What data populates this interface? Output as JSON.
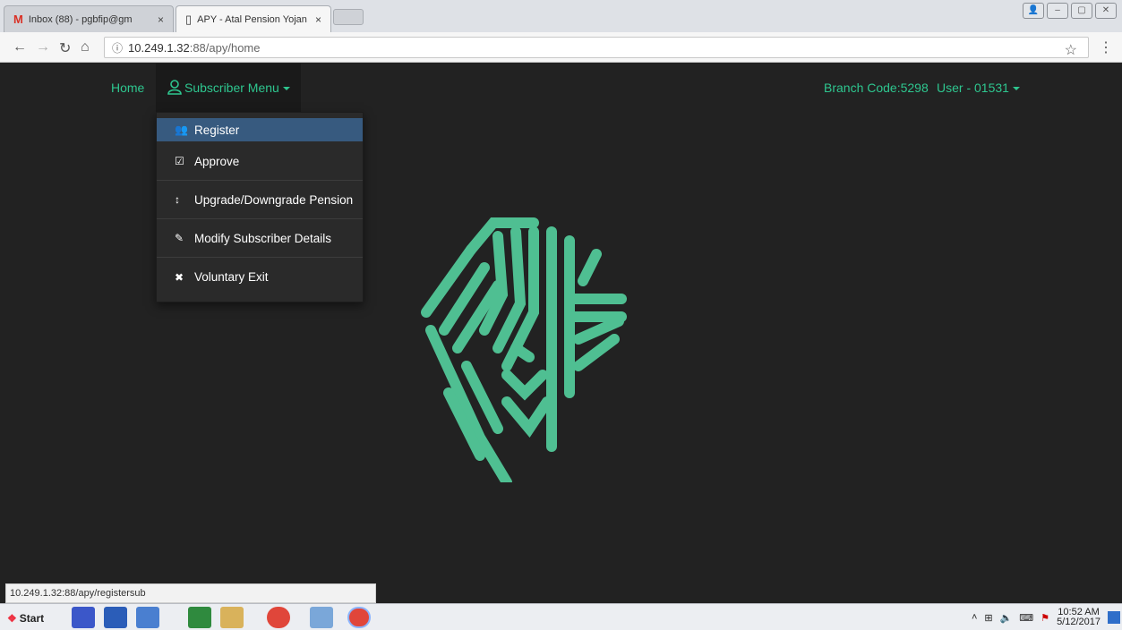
{
  "browser": {
    "tabs": [
      {
        "title": "Inbox (88) - pgbfip@gm",
        "favicon": "gmail-icon"
      },
      {
        "title": "APY - Atal Pension Yojan",
        "favicon": "page-icon"
      }
    ],
    "url_host": "10.249.1.32",
    "url_rest": ":88/apy/home",
    "close_glyph": "×"
  },
  "nav": {
    "home": "Home",
    "subscriber_menu": "Subscriber Menu",
    "branch_code": "Branch Code:5298",
    "user": "User - 01531"
  },
  "dropdown": [
    {
      "label": "Register",
      "icon": "add-user-icon",
      "glyph": "👥"
    },
    {
      "label": "Approve",
      "icon": "checkbox-icon",
      "glyph": "☑"
    },
    {
      "label": "Upgrade/Downgrade Pension",
      "icon": "vertical-arrows-icon",
      "glyph": "↕"
    },
    {
      "label": "Modify Subscriber Details",
      "icon": "pencil-icon",
      "glyph": "✎"
    },
    {
      "label": "Voluntary Exit",
      "icon": "close-icon",
      "glyph": "✖"
    }
  ],
  "status_url": "10.249.1.32:88/apy/registersub",
  "taskbar": {
    "start": "Start",
    "time": "10:52 AM",
    "date": "5/12/2017"
  },
  "colors": {
    "accent": "#2ec68f",
    "active_item": "#375a7f",
    "background": "#222222"
  }
}
